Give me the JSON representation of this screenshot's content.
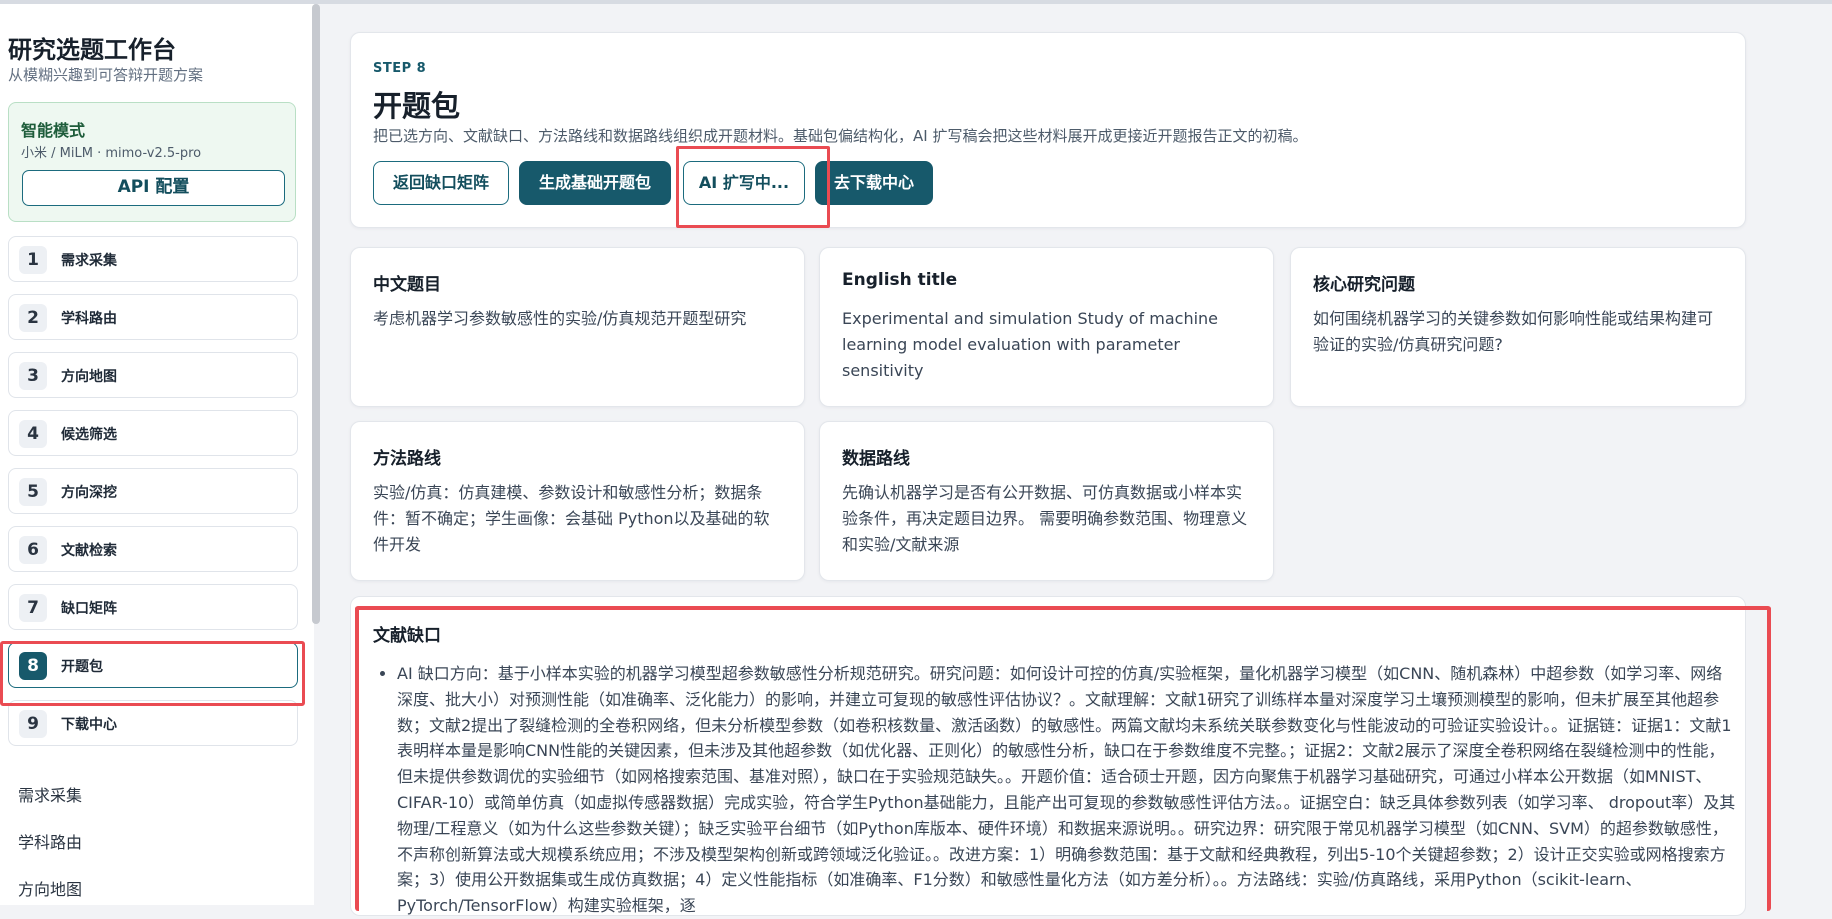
{
  "sidebar": {
    "title": "研究选题工作台",
    "subtitle": "从模糊兴趣到可答辩开题方案",
    "mode": {
      "title": "智能模式",
      "model": "小米 / MiLM · mimo-v2.5-pro",
      "api_button": "API 配置"
    },
    "steps": [
      {
        "num": "1",
        "label": "需求采集"
      },
      {
        "num": "2",
        "label": "学科路由"
      },
      {
        "num": "3",
        "label": "方向地图"
      },
      {
        "num": "4",
        "label": "候选筛选"
      },
      {
        "num": "5",
        "label": "方向深挖"
      },
      {
        "num": "6",
        "label": "文献检索"
      },
      {
        "num": "7",
        "label": "缺口矩阵"
      },
      {
        "num": "8",
        "label": "开题包"
      },
      {
        "num": "9",
        "label": "下载中心"
      }
    ],
    "active_step": "8",
    "links": [
      "需求采集",
      "学科路由",
      "方向地图"
    ]
  },
  "header": {
    "kicker": "STEP 8",
    "title": "开题包",
    "description": "把已选方向、文献缺口、方法路线和数据路线组织成开题材料。基础包偏结构化，AI 扩写稿会把这些材料展开成更接近开题报告正文的初稿。",
    "buttons": {
      "back": "返回缺口矩阵",
      "generate": "生成基础开题包",
      "ai_expand": "AI 扩写中...",
      "download": "去下载中心"
    }
  },
  "cards": {
    "cn_title": {
      "heading": "中文题目",
      "body": "考虑机器学习参数敏感性的实验/仿真规范开题型研究"
    },
    "en_title": {
      "heading": "English title",
      "body": "Experimental and simulation Study of machine learning model evaluation with parameter sensitivity"
    },
    "core_question": {
      "heading": "核心研究问题",
      "body": "如何围绕机器学习的关键参数如何影响性能或结果构建可验证的实验/仿真研究问题?"
    },
    "method_route": {
      "heading": "方法路线",
      "body": "实验/仿真：仿真建模、参数设计和敏感性分析；数据条件：暂不确定；学生画像：会基础 Python以及基础的软件开发"
    },
    "data_route": {
      "heading": "数据路线",
      "body": "先确认机器学习是否有公开数据、可仿真数据或小样本实验条件，再决定题目边界。 需要明确参数范围、物理意义和实验/文献来源"
    }
  },
  "gap": {
    "heading": "文献缺口",
    "items": [
      "AI 缺口方向：基于小样本实验的机器学习模型超参数敏感性分析规范研究。研究问题：如何设计可控的仿真/实验框架，量化机器学习模型（如CNN、随机森林）中超参数（如学习率、网络深度、批大小）对预测性能（如准确率、泛化能力）的影响，并建立可复现的敏感性评估协议？。文献理解：文献1研究了训练样本量对深度学习土壤预测模型的影响，但未扩展至其他超参数；文献2提出了裂缝检测的全卷积网络，但未分析模型参数（如卷积核数量、激活函数）的敏感性。两篇文献均未系统关联参数变化与性能波动的可验证实验设计。。证据链：证据1：文献1表明样本量是影响CNN性能的关键因素，但未涉及其他超参数（如优化器、正则化）的敏感性分析，缺口在于参数维度不完整。；证据2：文献2展示了深度全卷积网络在裂缝检测中的性能，但未提供参数调优的实验细节（如网格搜索范围、基准对照），缺口在于实验规范缺失。。开题价值：适合硕士开题，因方向聚焦于机器学习基础研究，可通过小样本公开数据（如MNIST、CIFAR-10）或简单仿真（如虚拟传感器数据）完成实验，符合学生Python基础能力，且能产出可复现的参数敏感性评估方法。。证据空白：缺乏具体参数列表（如学习率、 dropout率）及其物理/工程意义（如为什么这些参数关键）；缺乏实验平台细节（如Python库版本、硬件环境）和数据来源说明。。研究边界：研究限于常见机器学习模型（如CNN、SVM）的超参数敏感性，不声称创新算法或大规模系统应用；不涉及模型架构创新或跨领域泛化验证。。改进方案：1）明确参数范围：基于文献和经典教程，列出5-10个关键超参数；2）设计正交实验或网格搜索方案；3）使用公开数据集或生成仿真数据；4）定义性能指标（如准确率、F1分数）和敏感性量化方法（如方差分析）。。方法路线：实验/仿真路线，采用Python（scikit-learn、PyTorch/TensorFlow）构建实验框架，逐"
    ]
  }
}
